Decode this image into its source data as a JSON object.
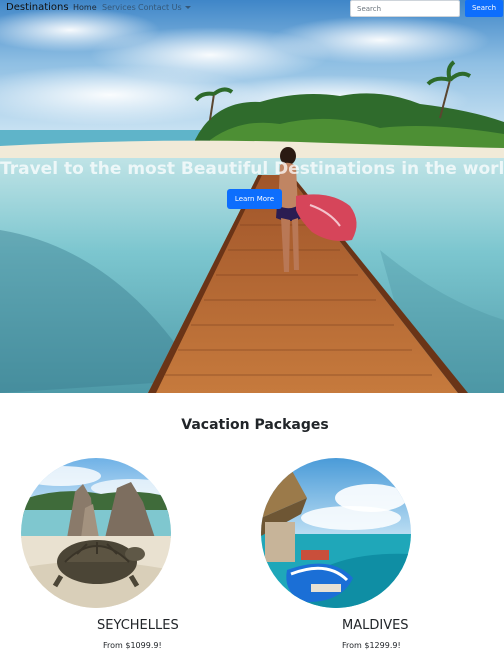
{
  "navbar": {
    "brand": "Destinations",
    "links": [
      {
        "label": "Home"
      },
      {
        "label": "Services"
      },
      {
        "label": "Contact Us"
      }
    ],
    "search_placeholder": "Search",
    "search_button": "Search"
  },
  "hero": {
    "title": "Travel to the most Beautiful Destinations in the world",
    "button": "Learn More"
  },
  "packages": {
    "title": "Vacation Packages",
    "items": [
      {
        "name": "SEYCHELLES",
        "price": "From $1099.9!"
      },
      {
        "name": "MALDIVES",
        "price": "From $1299.9!"
      }
    ]
  },
  "colors": {
    "primary": "#0d6efd",
    "text": "#212529",
    "background": "#ffffff"
  }
}
